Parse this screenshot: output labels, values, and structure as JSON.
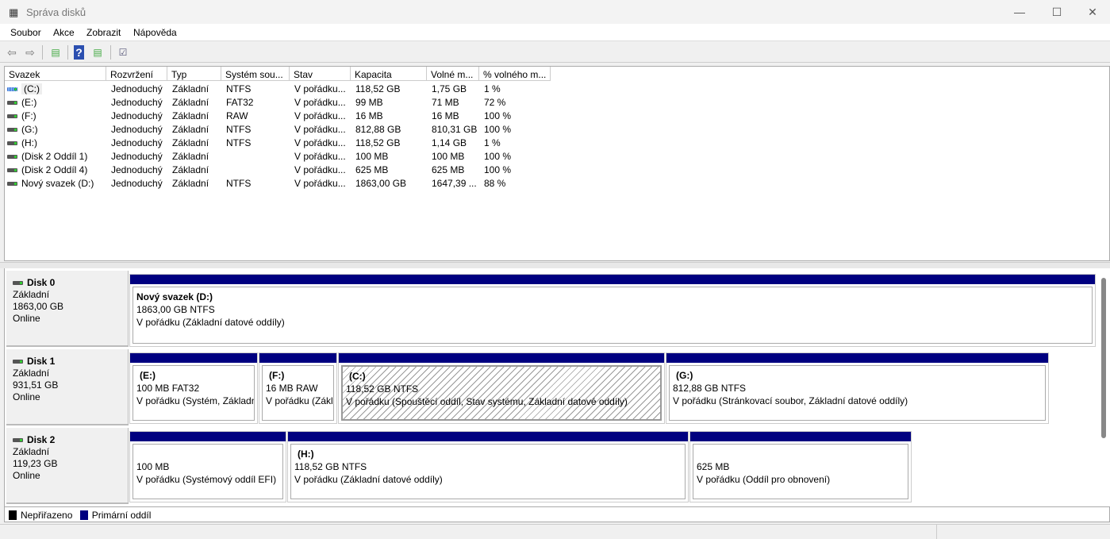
{
  "window": {
    "title": "Správa disků",
    "minimize": "—",
    "maximize": "☐",
    "close": "✕"
  },
  "menu": [
    "Soubor",
    "Akce",
    "Zobrazit",
    "Nápověda"
  ],
  "toolbar": {
    "back": "⇦",
    "forward": "⇨",
    "help": "?"
  },
  "columns": [
    "Svazek",
    "Rozvržení",
    "Typ",
    "Systém sou...",
    "Stav",
    "Kapacita",
    "Volné m...",
    "% volného m..."
  ],
  "volumes": [
    [
      "(C:)",
      "Jednoduchý",
      "Základní",
      "NTFS",
      "V pořádku...",
      "118,52 GB",
      "1,75 GB",
      "1 %"
    ],
    [
      "(E:)",
      "Jednoduchý",
      "Základní",
      "FAT32",
      "V pořádku...",
      "99 MB",
      "71 MB",
      "72 %"
    ],
    [
      "(F:)",
      "Jednoduchý",
      "Základní",
      "RAW",
      "V pořádku...",
      "16 MB",
      "16 MB",
      "100 %"
    ],
    [
      "(G:)",
      "Jednoduchý",
      "Základní",
      "NTFS",
      "V pořádku...",
      "812,88 GB",
      "810,31 GB",
      "100 %"
    ],
    [
      "(H:)",
      "Jednoduchý",
      "Základní",
      "NTFS",
      "V pořádku...",
      "118,52 GB",
      "1,14 GB",
      "1 %"
    ],
    [
      "(Disk 2 Oddíl 1)",
      "Jednoduchý",
      "Základní",
      "",
      "V pořádku...",
      "100 MB",
      "100 MB",
      "100 %"
    ],
    [
      "(Disk 2 Oddíl 4)",
      "Jednoduchý",
      "Základní",
      "",
      "V pořádku...",
      "625 MB",
      "625 MB",
      "100 %"
    ],
    [
      "Nový svazek (D:)",
      "Jednoduchý",
      "Základní",
      "NTFS",
      "V pořádku...",
      "1863,00 GB",
      "1647,39 ...",
      "88 %"
    ]
  ],
  "disks": [
    {
      "name": "Disk 0",
      "type": "Základní",
      "size": "1863,00 GB",
      "status": "Online",
      "partitions": [
        {
          "title": "Nový svazek  (D:)",
          "size": "1863,00 GB NTFS",
          "status": "V pořádku (Základní datové oddíly)"
        }
      ]
    },
    {
      "name": "Disk 1",
      "type": "Základní",
      "size": "931,51 GB",
      "status": "Online",
      "partitions": [
        {
          "title": "(E:)",
          "size": "100 MB FAT32",
          "status": "V pořádku (Systém, Základn"
        },
        {
          "title": "(F:)",
          "size": "16 MB RAW",
          "status": "V pořádku (Zákl"
        },
        {
          "title": "(C:)",
          "size": "118,52 GB NTFS",
          "status": "V pořádku (Spouštěcí oddíl, Stav systému, Základní datové oddíly)",
          "selected": true
        },
        {
          "title": "(G:)",
          "size": "812,88 GB NTFS",
          "status": "V pořádku (Stránkovací soubor, Základní datové oddíly)"
        }
      ]
    },
    {
      "name": "Disk 2",
      "type": "Základní",
      "size": "119,23 GB",
      "status": "Online",
      "partitions": [
        {
          "title": "",
          "size": "100 MB",
          "status": "V pořádku (Systémový oddíl EFI)"
        },
        {
          "title": "(H:)",
          "size": "118,52 GB NTFS",
          "status": "V pořádku (Základní datové oddíly)"
        },
        {
          "title": "",
          "size": "625 MB",
          "status": "V pořádku (Oddíl pro obnovení)"
        }
      ]
    }
  ],
  "legend": [
    {
      "label": "Nepřiřazeno",
      "color": "#000000"
    },
    {
      "label": "Primární oddíl",
      "color": "#000080"
    }
  ]
}
